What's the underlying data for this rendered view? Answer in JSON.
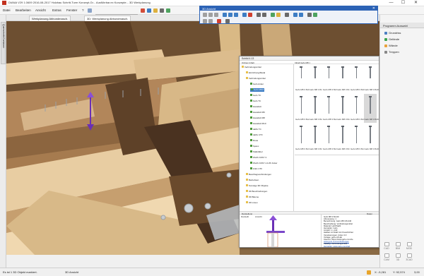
{
  "window": {
    "title": "DIANA V29 1.0609 2016-08-2017 Holzbau Schritt-Turm Konzept-Gr...  Ausführbar.ex Konzepte...  3D Werkplanung",
    "controls": [
      "—",
      "☐",
      "✕"
    ]
  },
  "menu": {
    "items": [
      "Datei",
      "Bearbeiten",
      "Ansicht",
      "Extras",
      "Fenster",
      "?"
    ],
    "workplane_select": "3D: Werkplanung Abb"
  },
  "tabs": [
    {
      "label": "Werkplanung Abbundmasch.",
      "active": false
    },
    {
      "label": "3D: Werkplanung Abbundmasch.",
      "active": true
    }
  ],
  "left_strip": {
    "label": "Querschnitt-Container"
  },
  "panel3d": {
    "title": "3D Ansicht",
    "close": "✕"
  },
  "right_panel": {
    "header": "Programm Auswahl",
    "items": [
      {
        "label": "Grundriss",
        "color": "#4c7fc2"
      },
      {
        "label": "Gelände",
        "color": "#3aa34d"
      },
      {
        "label": "Wände",
        "color": "#e9a23b"
      },
      {
        "label": "Treppen",
        "color": "#888888"
      }
    ],
    "modes": [
      "CAD",
      "BIM",
      "MOD",
      "CAM",
      "3D",
      "3CAD"
    ]
  },
  "catalog": {
    "title": "Schild 4.13",
    "tree_header": "Ordner-Inhalt",
    "list_header": "Inhalt Gefo M8 ×",
    "tree": [
      {
        "label": "Verbindungsmittel",
        "level": 0,
        "color": "#e7c04a"
      },
      {
        "label": "Einrichtung/Metal",
        "level": 1,
        "color": "#e7c04a"
      },
      {
        "label": "Verbindungsmittel",
        "level": 1,
        "color": "#e7c04a"
      },
      {
        "label": "Gefo Anker",
        "level": 2,
        "color": "#4e9a3a"
      },
      {
        "label": "Gefo M8.8",
        "level": 2,
        "color": "#4e9a3a",
        "selected": true
      },
      {
        "label": "Gefo TC",
        "level": 2,
        "color": "#4e9a3a"
      },
      {
        "label": "Gefo TC",
        "level": 2,
        "color": "#4e9a3a"
      },
      {
        "label": "Haxabolt",
        "level": 2,
        "color": "#4e9a3a"
      },
      {
        "label": "Haxabolt M6",
        "level": 2,
        "color": "#4e9a3a"
      },
      {
        "label": "Haxabolt M8",
        "level": 2,
        "color": "#4e9a3a"
      },
      {
        "label": "Haxabolt M10",
        "level": 2,
        "color": "#4e9a3a"
      },
      {
        "label": "dalfix TC",
        "level": 2,
        "color": "#4e9a3a"
      },
      {
        "label": "dalfix CTF",
        "level": 2,
        "color": "#4e9a3a"
      },
      {
        "label": "Rosa",
        "level": 2,
        "color": "#4e9a3a"
      },
      {
        "label": "Spaxx",
        "level": 2,
        "color": "#4e9a3a"
      },
      {
        "label": "Stabdübel",
        "level": 2,
        "color": "#4e9a3a"
      },
      {
        "label": "Wurth ASSY 3",
        "level": 2,
        "color": "#4e9a3a"
      },
      {
        "label": "Wurth ASSY mit ZF Anker",
        "level": 2,
        "color": "#4e9a3a"
      },
      {
        "label": "Zufix CTF",
        "level": 2,
        "color": "#4e9a3a"
      },
      {
        "label": "Beschlagsverbindungen",
        "level": 1,
        "color": "#e7c04a"
      },
      {
        "label": "Betriebsen",
        "level": 1,
        "color": "#e7c04a"
      },
      {
        "label": "Sonstige 3D Objekte",
        "level": 1,
        "color": "#e7c04a"
      },
      {
        "label": "3D Beschreibungen",
        "level": 1,
        "color": "#e7c04a"
      },
      {
        "label": "3D Bäume",
        "level": 1,
        "color": "#e7c04a"
      },
      {
        "label": "3D Linien",
        "level": 1,
        "color": "#e7c04a"
      }
    ],
    "grid": [
      [
        "Gefo M8 3 8x100",
        "Gefo M8 3 8x120",
        "Gefo M8 3 8x140",
        "Gefo M8 3 8x160",
        "Gefo M8 3 8x180",
        "Gefo M8 3 8x200"
      ],
      [
        "Gefo M8 3 8x220",
        "Gefo M8 3 8x240",
        "Gefo M8 3 8x260",
        "Gefo M8 3 8x280",
        "Gefo M8 3 8x300",
        "Gefo M8 3 8x60"
      ],
      [
        "Gefo M8 3 8x320",
        "Gefo M8 3 8x340",
        "Gefo M8 3 8x360",
        "Gefo M8 3 8x380",
        "Gefo M8 3 8x400",
        "Gefo M8 3 8x400"
      ]
    ],
    "selected_cell": [
      1,
      5
    ],
    "details_header": "Darstellung",
    "preview_tabs": [
      "Darstellt",
      "Ansicht"
    ],
    "info_header": "Daten",
    "info": [
      "Gefo M8 3 8x140",
      "Abmessung: 1",
      "Bezeichnung: Gefo M8 3 8x140",
      "Beschreibung: Verbindungsmittel",
      "Material: Holz/Stahl",
      "Hersteller: Gefo",
      "Anzahl: 1 x 140",
      "Haltbar mit Stahl 12.2 beschichtet",
      "Verankerungen: Anker 4.0",
      "Vorlage: gefo-m8.dat",
      "Internet: https://www.gefo.com/de",
      "www.gefo.com/verbindungen",
      "Katalog: Verbindungsmittel",
      "Hersteller: www.gefo.com/cad"
    ]
  },
  "status": {
    "left": "Es ist 1 3D Objekt markiert.",
    "view": "3D Ansicht",
    "x": "X: -5,281",
    "y": "Y: 92,574",
    "zoom": "3,00"
  }
}
